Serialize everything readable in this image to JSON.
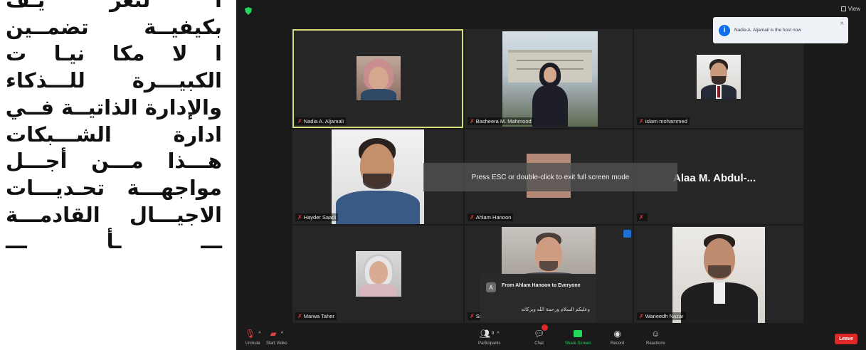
{
  "article": {
    "lines": [
      "أ لتعر يـف",
      "بكيفيــة تضمــين",
      "ا لا مكا نيـا ت",
      "الكبيـــرة للـــذكاء",
      "والإدارة الذاتيــة فــي",
      "ادارة الشـــبكات",
      "هـــذا مـــن أجـــل",
      "مواجهـــة تحـديـــات",
      "الاجيـــال القادمـــة",
      "ـــ ـأ ـــ"
    ]
  },
  "zoom": {
    "view_label": "View",
    "notification": {
      "text": "Nadia A. Aljamali is the host now"
    },
    "fullscreen_message": "Press ESC or double-click to exit full screen mode",
    "participants": [
      {
        "name": "Nadia A. Aljamali",
        "active": true
      },
      {
        "name": "Basheera M. Mahmood",
        "active": false
      },
      {
        "name": "islam mohammed",
        "active": false
      },
      {
        "name": "Hayder Saadi",
        "active": false
      },
      {
        "name": "Ahlam Hanoon",
        "active": false
      },
      {
        "name": "",
        "display_name": "Alaa M. Abdul-...",
        "active": false
      },
      {
        "name": "Marwa Taher",
        "active": false
      },
      {
        "name": "Sa",
        "active": false
      },
      {
        "name": "Waneedh Nazar",
        "active": false
      }
    ],
    "chat_popup": {
      "avatar_letter": "A",
      "from": "From Ahlam Hanoon to Everyone",
      "message": "وعليكم السلام ورحمة الله وبركاته"
    },
    "toolbar": {
      "unmute": "Unmute",
      "start_video": "Start Video",
      "participants": "Participants",
      "participants_count": "9",
      "chat": "Chat",
      "share_screen": "Share Screen",
      "record": "Record",
      "reactions": "Reactions",
      "leave": "Leave"
    },
    "colors": {
      "active_speaker": "#d6dc7a",
      "share_green": "#23d959",
      "leave_red": "#e02828",
      "info_blue": "#0e71eb"
    }
  }
}
